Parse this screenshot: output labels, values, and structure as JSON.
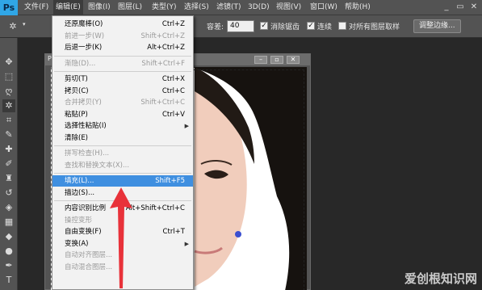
{
  "app": {
    "logo": "Ps"
  },
  "menubar": {
    "items": [
      "文件(F)",
      "编辑(E)",
      "图像(I)",
      "图层(L)",
      "类型(Y)",
      "选择(S)",
      "滤镜(T)",
      "3D(D)",
      "视图(V)",
      "窗口(W)",
      "帮助(H)"
    ],
    "active_index": 1
  },
  "window_controls": {
    "minimize": "_",
    "restore": "▭",
    "close": "✕"
  },
  "options": {
    "tolerance_label": "容差:",
    "tolerance_value": "40",
    "antialias_label": "消除锯齿",
    "contiguous_label": "连续",
    "sample_all_label": "对所有图层取样",
    "refine_edge_button": "调整边缘..."
  },
  "document": {
    "tab_label": "P"
  },
  "edit_menu": {
    "items": [
      {
        "label": "还原魔棒(O)",
        "shortcut": "Ctrl+Z",
        "disabled": false
      },
      {
        "label": "前进一步(W)",
        "shortcut": "Shift+Ctrl+Z",
        "disabled": true
      },
      {
        "label": "后退一步(K)",
        "shortcut": "Alt+Ctrl+Z",
        "disabled": false
      },
      {
        "separator": true
      },
      {
        "label": "渐隐(D)...",
        "shortcut": "Shift+Ctrl+F",
        "disabled": true
      },
      {
        "separator": true
      },
      {
        "label": "剪切(T)",
        "shortcut": "Ctrl+X",
        "disabled": false
      },
      {
        "label": "拷贝(C)",
        "shortcut": "Ctrl+C",
        "disabled": false
      },
      {
        "label": "合并拷贝(Y)",
        "shortcut": "Shift+Ctrl+C",
        "disabled": true
      },
      {
        "label": "粘贴(P)",
        "shortcut": "Ctrl+V",
        "disabled": false
      },
      {
        "label": "选择性粘贴(I)",
        "shortcut": "",
        "disabled": false,
        "submenu": true
      },
      {
        "label": "清除(E)",
        "shortcut": "",
        "disabled": false
      },
      {
        "separator": true
      },
      {
        "label": "拼写检查(H)...",
        "shortcut": "",
        "disabled": true
      },
      {
        "label": "查找和替换文本(X)...",
        "shortcut": "",
        "disabled": true
      },
      {
        "separator": true
      },
      {
        "label": "填充(L)...",
        "shortcut": "Shift+F5",
        "disabled": false,
        "highlighted": true
      },
      {
        "label": "描边(S)...",
        "shortcut": "",
        "disabled": false
      },
      {
        "separator": true
      },
      {
        "label": "内容识别比例",
        "shortcut": "Alt+Shift+Ctrl+C",
        "disabled": false
      },
      {
        "label": "操控变形",
        "shortcut": "",
        "disabled": true
      },
      {
        "label": "自由变换(F)",
        "shortcut": "Ctrl+T",
        "disabled": false
      },
      {
        "label": "变换(A)",
        "shortcut": "",
        "disabled": false,
        "submenu": true
      },
      {
        "label": "自动对齐图层...",
        "shortcut": "",
        "disabled": true
      },
      {
        "label": "自动混合图层...",
        "shortcut": "",
        "disabled": true
      }
    ]
  },
  "annotation": {
    "arrow_color": "#e8323a"
  },
  "watermark": "爱创根知识网"
}
